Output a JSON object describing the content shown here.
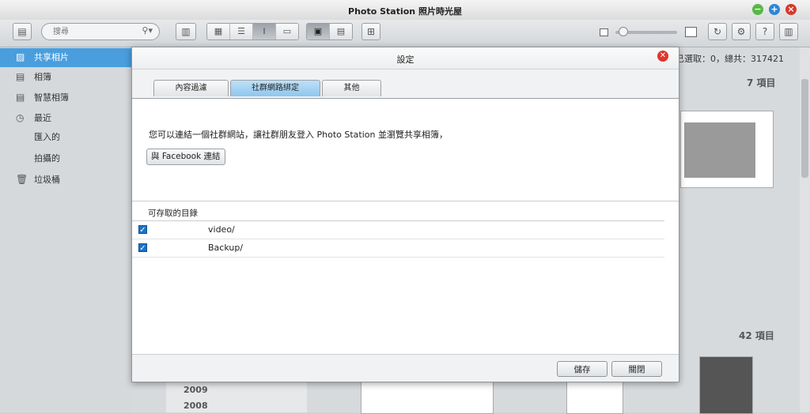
{
  "window": {
    "title": "Photo Station 照片時光屋"
  },
  "toolbar": {
    "search_placeholder": "搜尋"
  },
  "sidebar": {
    "items": [
      {
        "label": "共享相片",
        "icon": "picture-icon"
      },
      {
        "label": "相簿",
        "icon": "album-icon"
      },
      {
        "label": "智慧相簿",
        "icon": "smart-album-icon"
      },
      {
        "label": "最近",
        "icon": "clock-icon"
      },
      {
        "label": "匯入的",
        "icon": ""
      },
      {
        "label": "拍攝的",
        "icon": ""
      },
      {
        "label": "垃圾桶",
        "icon": "trash-icon"
      }
    ]
  },
  "background": {
    "status": "已選取：0，總共：317421",
    "count1": "7 項目",
    "count2": "42 項目",
    "year1": "2009",
    "year2": "2008"
  },
  "dialog": {
    "title": "設定",
    "tabs": [
      "內容過濾",
      "社群網路綁定",
      "其他"
    ],
    "intro": "您可以連結一個社群網站，讓社群朋友登入 Photo Station 並瀏覽共享相簿，",
    "facebook_button": "與 Facebook 連結",
    "section_title": "可存取的目錄",
    "directories": [
      {
        "name": "video/",
        "checked": true
      },
      {
        "name": "Backup/",
        "checked": true
      }
    ],
    "save_button": "儲存",
    "close_button": "關閉"
  }
}
